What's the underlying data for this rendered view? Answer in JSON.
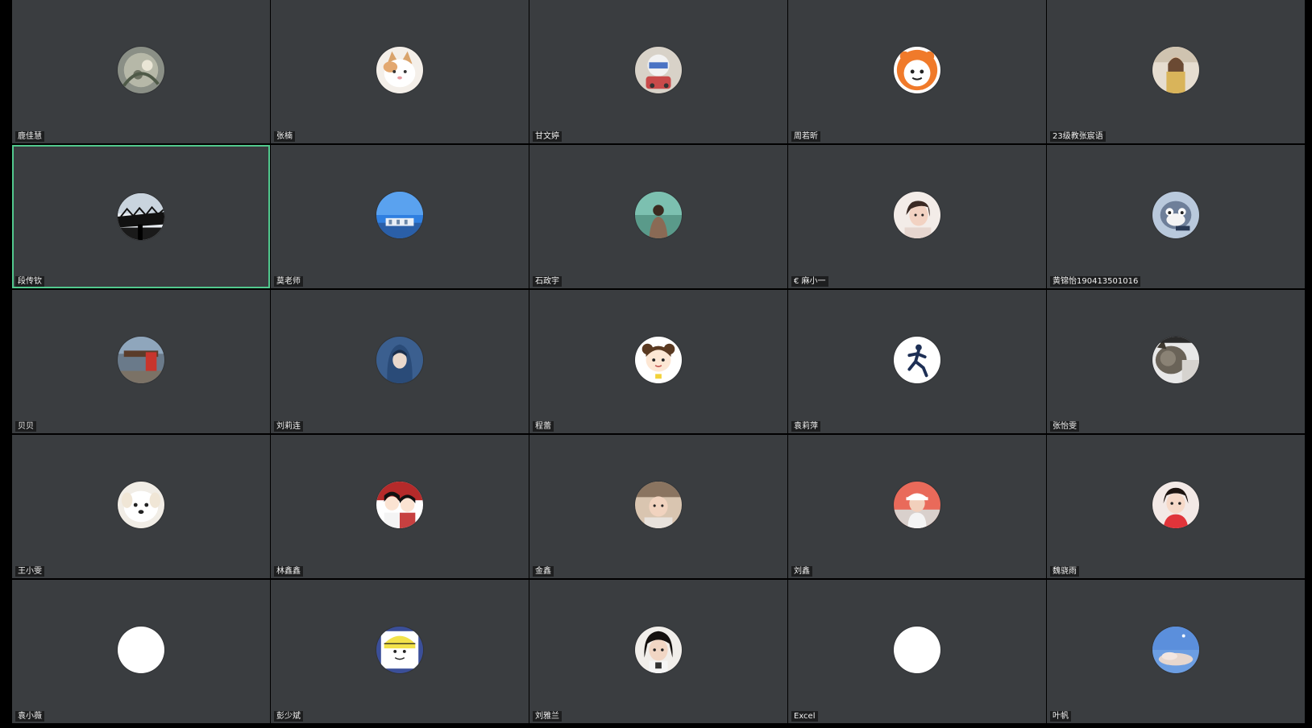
{
  "participants": [
    {
      "name": "鹿佳慧",
      "avatar": "flower-photo-avatar",
      "active": false
    },
    {
      "name": "张楠",
      "avatar": "cat-photo-avatar",
      "active": false
    },
    {
      "name": "甘文婷",
      "avatar": "cartoon-character-avatar",
      "active": false
    },
    {
      "name": "周若昕",
      "avatar": "orange-cartoon-avatar",
      "active": false
    },
    {
      "name": "23级教张宸语",
      "avatar": "girl-photo-avatar",
      "active": false
    },
    {
      "name": "段传钦",
      "avatar": "bridge-silhouette-avatar",
      "active": true
    },
    {
      "name": "莫老师",
      "avatar": "blue-sky-building-avatar",
      "active": false
    },
    {
      "name": "石政宇",
      "avatar": "person-nature-avatar",
      "active": false
    },
    {
      "name": "€ 麻小一",
      "avatar": "girl-portrait-avatar",
      "active": false
    },
    {
      "name": "黄锦怡190413501016",
      "avatar": "cartoon-cat-avatar",
      "active": false
    },
    {
      "name": "贝贝",
      "avatar": "red-building-avatar",
      "active": false
    },
    {
      "name": "刘莉连",
      "avatar": "blue-hooded-figure-avatar",
      "active": false
    },
    {
      "name": "程蕾",
      "avatar": "cartoon-girl-avatar",
      "active": false
    },
    {
      "name": "袁莉萍",
      "avatar": "running-figure-avatar",
      "active": false
    },
    {
      "name": "张怡雯",
      "avatar": "cat-pet-avatar",
      "active": false
    },
    {
      "name": "王小雯",
      "avatar": "white-dog-avatar",
      "active": false
    },
    {
      "name": "林鑫鑫",
      "avatar": "illustrated-couple-avatar",
      "active": false
    },
    {
      "name": "金鑫",
      "avatar": "child-photo-avatar",
      "active": false
    },
    {
      "name": "刘鑫",
      "avatar": "girl-hat-avatar",
      "active": false
    },
    {
      "name": "魏骁雨",
      "avatar": "girl-red-top-avatar",
      "active": false
    },
    {
      "name": "袁小薇",
      "avatar": "default-blank-avatar",
      "active": false
    },
    {
      "name": "彭少斌",
      "avatar": "anime-character-avatar",
      "active": false
    },
    {
      "name": "刘雅兰",
      "avatar": "dark-hair-portrait-avatar",
      "active": false
    },
    {
      "name": "Excel",
      "avatar": "default-blank-avatar",
      "active": false
    },
    {
      "name": "叶帆",
      "avatar": "sky-clouds-avatar",
      "active": false
    }
  ],
  "colors": {
    "tile_background": "#3a3d40",
    "page_background": "#000000",
    "active_border": "#52c98e",
    "name_text": "#f2f2f2"
  }
}
